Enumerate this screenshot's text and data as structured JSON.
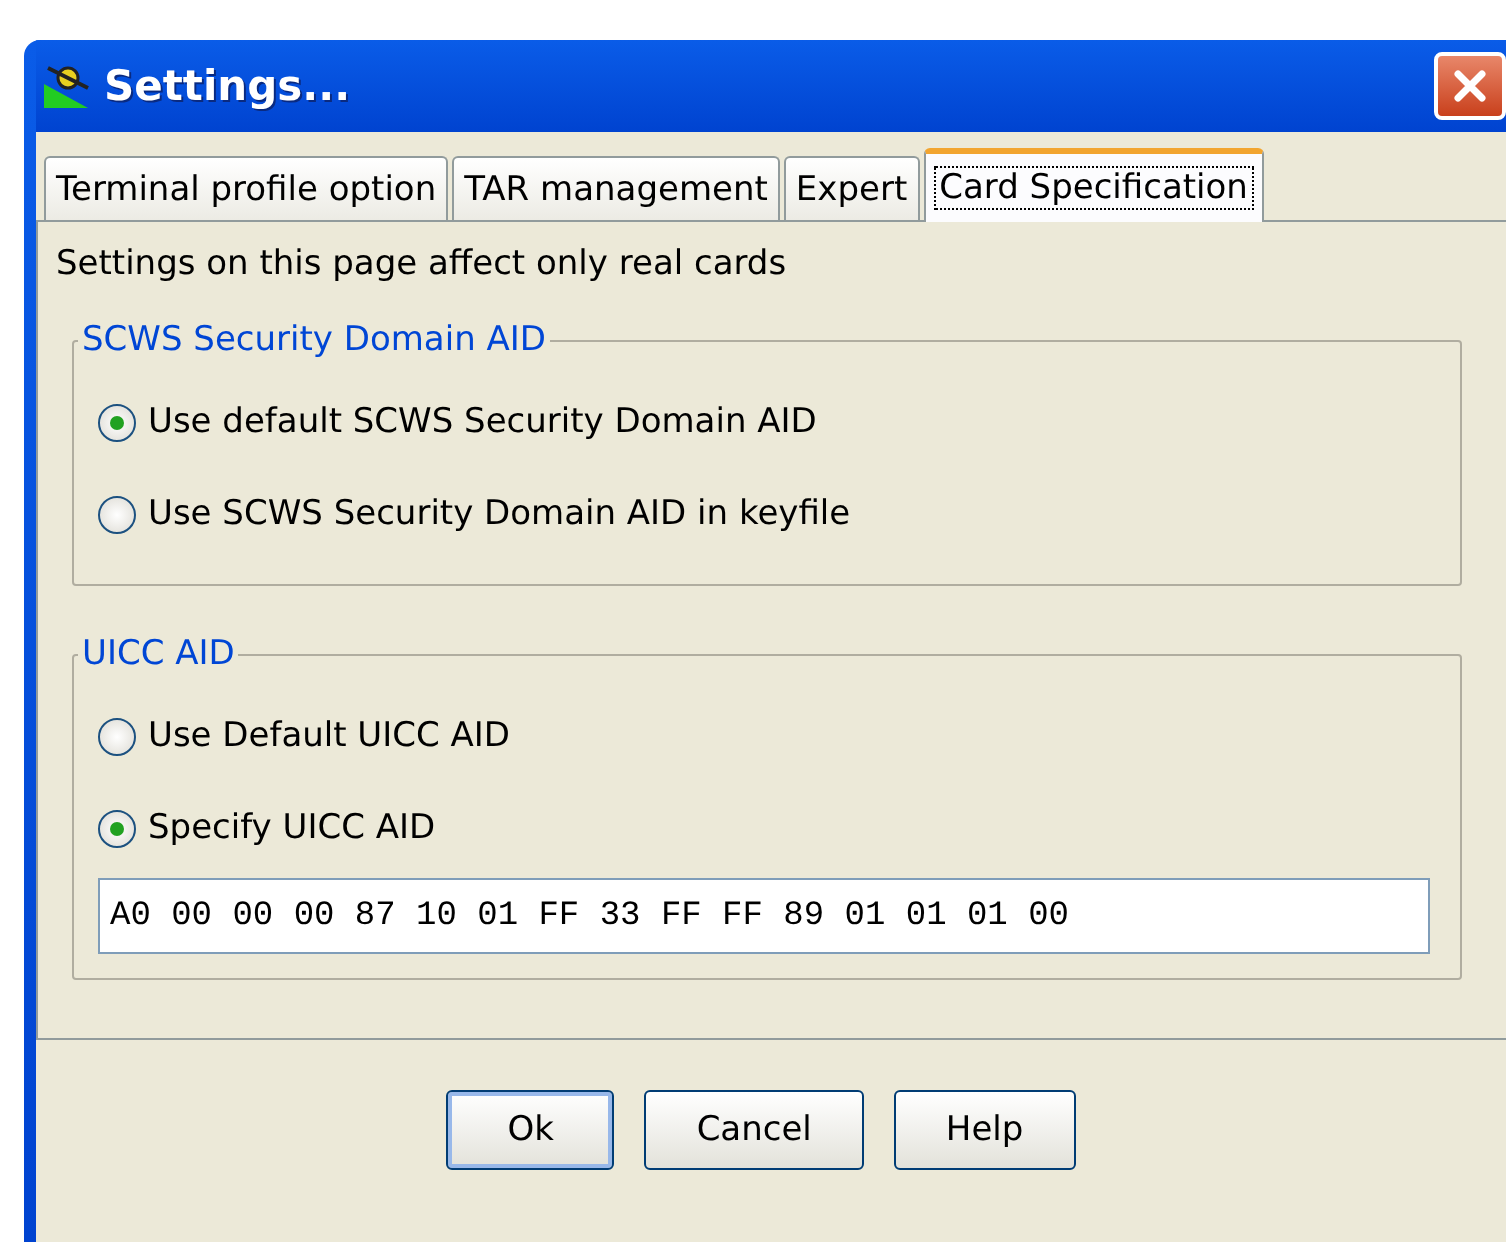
{
  "window": {
    "title": "Settings..."
  },
  "tabs": [
    {
      "label": "Terminal profile option",
      "selected": false
    },
    {
      "label": "TAR management",
      "selected": false
    },
    {
      "label": "Expert",
      "selected": false
    },
    {
      "label": "Card Specification",
      "selected": true
    }
  ],
  "note": "Settings on this page affect only real cards",
  "groups": [
    {
      "title": "SCWS Security Domain AID",
      "options": [
        {
          "label": "Use default SCWS Security Domain AID",
          "selected": true
        },
        {
          "label": "Use SCWS Security Domain AID in keyfile",
          "selected": false
        }
      ]
    },
    {
      "title": "UICC AID",
      "options": [
        {
          "label": "Use Default UICC AID",
          "selected": false
        },
        {
          "label": "Specify UICC AID",
          "selected": true
        }
      ],
      "field": {
        "value": "A0 00 00 00 87 10 01 FF 33 FF FF 89 01 01 01 00"
      }
    }
  ],
  "buttons": [
    {
      "label": "Ok",
      "default": true
    },
    {
      "label": "Cancel",
      "default": false
    },
    {
      "label": "Help",
      "default": false
    }
  ]
}
